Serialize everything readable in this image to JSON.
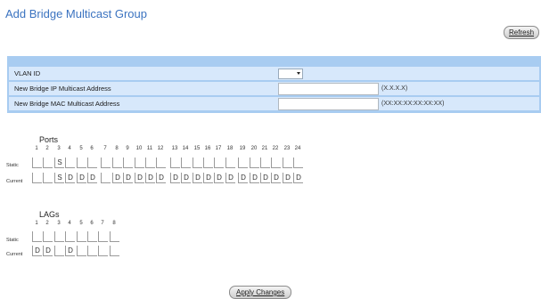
{
  "page": {
    "title": "Add Bridge Multicast Group"
  },
  "buttons": {
    "refresh": "Refresh",
    "apply": "Apply Changes"
  },
  "form": {
    "vlan_label": "VLAN ID",
    "vlan_value": "",
    "ip_label": "New Bridge IP Multicast Address",
    "ip_value": "",
    "ip_hint": "(X.X.X.X)",
    "mac_label": "New Bridge MAC Multicast Address",
    "mac_value": "",
    "mac_hint": "(XX:XX:XX:XX:XX:XX)"
  },
  "ports": {
    "title": "Ports",
    "static_label": "Static",
    "current_label": "Current",
    "numbers": [
      "1",
      "2",
      "3",
      "4",
      "5",
      "6",
      "7",
      "8",
      "9",
      "10",
      "11",
      "12",
      "13",
      "14",
      "15",
      "16",
      "17",
      "18",
      "19",
      "20",
      "21",
      "22",
      "23",
      "24"
    ],
    "static": [
      "",
      "",
      "S",
      "",
      "",
      "",
      "",
      "",
      "",
      "",
      "",
      "",
      "",
      "",
      "",
      "",
      "",
      "",
      "",
      "",
      "",
      "",
      "",
      ""
    ],
    "current": [
      "",
      "",
      "S",
      "D",
      "D",
      "D",
      "",
      "D",
      "D",
      "D",
      "D",
      "D",
      "D",
      "D",
      "D",
      "D",
      "D",
      "D",
      "D",
      "D",
      "D",
      "D",
      "D",
      "D"
    ]
  },
  "lags": {
    "title": "LAGs",
    "static_label": "Static",
    "current_label": "Current",
    "numbers": [
      "1",
      "2",
      "3",
      "4",
      "5",
      "6",
      "7",
      "8"
    ],
    "static": [
      "",
      "",
      "",
      "",
      "",
      "",
      "",
      ""
    ],
    "current": [
      "D",
      "D",
      "",
      "D",
      "",
      "",
      "",
      ""
    ]
  }
}
